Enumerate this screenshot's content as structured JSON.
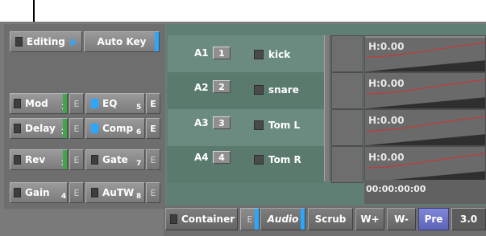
{
  "mode_buttons": {
    "editing": "Editing",
    "auto_key": "Auto Key"
  },
  "effects": [
    {
      "label": "Mod",
      "index": "1",
      "e": "E"
    },
    {
      "label": "Delay",
      "index": "2",
      "e": "E"
    },
    {
      "label": "Rev",
      "index": "3",
      "e": "E"
    },
    {
      "label": "Gain",
      "index": "4",
      "e": "E"
    }
  ],
  "effects_right": [
    {
      "label": "EQ",
      "index": "5",
      "e": "E"
    },
    {
      "label": "Comp",
      "index": "6",
      "e": "E"
    },
    {
      "label": "Gate",
      "index": "7",
      "e": "E"
    },
    {
      "label": "AuTW",
      "index": "8",
      "e": "E"
    }
  ],
  "tracks": [
    {
      "id": "A1",
      "num": "1",
      "name": "kick",
      "time": "H:0.00"
    },
    {
      "id": "A2",
      "num": "2",
      "name": "snare",
      "time": "H:0.00"
    },
    {
      "id": "A3",
      "num": "3",
      "name": "Tom L",
      "time": "H:0.00"
    },
    {
      "id": "A4",
      "num": "4",
      "name": "Tom R",
      "time": "H:0.00"
    }
  ],
  "timecode": "00:00:00:00",
  "bottom": {
    "container": "Container",
    "e": "E",
    "audio": "Audio",
    "scrub": "Scrub",
    "w_plus": "W+",
    "w_minus": "W-",
    "pre": "Pre",
    "value": "3.0"
  },
  "colors": {
    "accent_blue": "#2aa8ff",
    "indicator_green": "#3fa64a",
    "wave_curve": "#c23a3a",
    "track_panel": "#5f7f74"
  }
}
